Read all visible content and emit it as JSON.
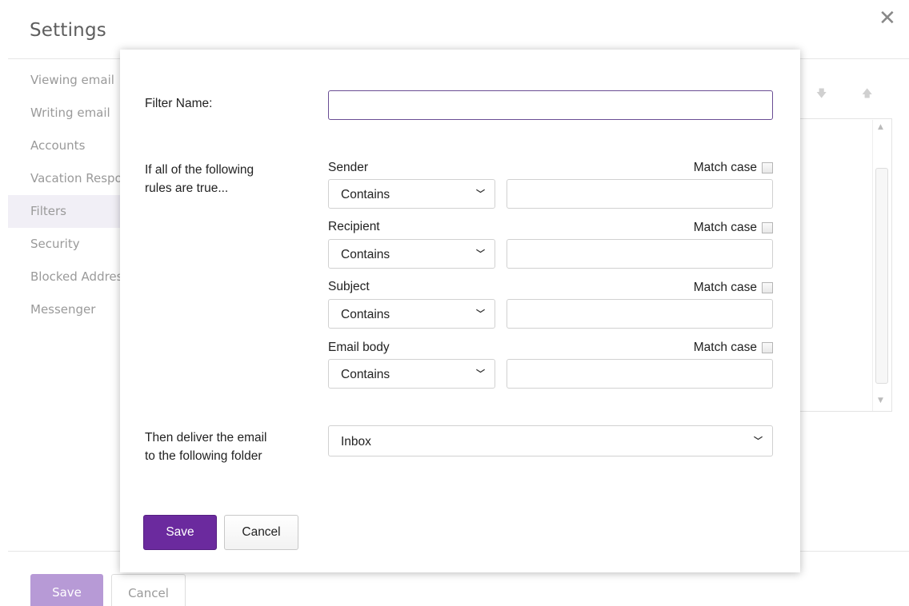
{
  "page": {
    "title": "Settings",
    "close_icon": "close-icon"
  },
  "nav": {
    "items": [
      {
        "label": "Viewing email"
      },
      {
        "label": "Writing email"
      },
      {
        "label": "Accounts"
      },
      {
        "label": "Vacation Response"
      },
      {
        "label": "Filters",
        "active": true
      },
      {
        "label": "Security"
      },
      {
        "label": "Blocked Addresses"
      },
      {
        "label": "Messenger"
      }
    ]
  },
  "footer": {
    "save_label": "Save",
    "cancel_label": "Cancel"
  },
  "dialog": {
    "filter_name_label": "Filter Name:",
    "filter_name_value": "",
    "rules_label_line1": "If all of the following",
    "rules_label_line2": "rules are true...",
    "rules": [
      {
        "field": "Sender",
        "operator": "Contains",
        "value": "",
        "match_case_label": "Match case",
        "match_case": false
      },
      {
        "field": "Recipient",
        "operator": "Contains",
        "value": "",
        "match_case_label": "Match case",
        "match_case": false
      },
      {
        "field": "Subject",
        "operator": "Contains",
        "value": "",
        "match_case_label": "Match case",
        "match_case": false
      },
      {
        "field": "Email body",
        "operator": "Contains",
        "value": "",
        "match_case_label": "Match case",
        "match_case": false
      }
    ],
    "deliver_label_line1": "Then deliver the email",
    "deliver_label_line2": "to the following folder",
    "folder": "Inbox",
    "save_label": "Save",
    "cancel_label": "Cancel"
  },
  "colors": {
    "accent": "#6b2a9e",
    "accent_disabled": "#b79ad6",
    "input_focus_border": "#6a4d94",
    "nav_active_bg": "#f1eff6"
  }
}
